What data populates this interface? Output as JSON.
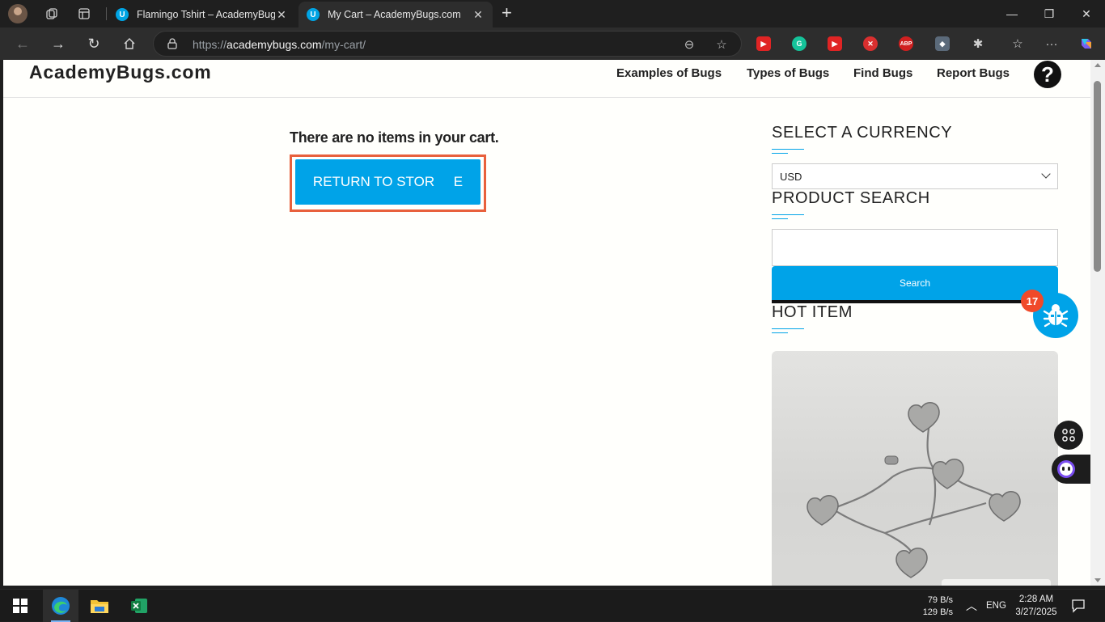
{
  "browser": {
    "tabs": [
      {
        "title": "Flamingo Tshirt – AcademyBugs.com",
        "favicon": "U",
        "active": false
      },
      {
        "title": "My Cart – AcademyBugs.com",
        "favicon": "U",
        "active": true
      }
    ],
    "url_scheme": "https://",
    "url_host": "academybugs.com",
    "url_path": "/my-cart/"
  },
  "site": {
    "logo": "AcademyBugs.com",
    "menu": [
      "Examples of Bugs",
      "Types of Bugs",
      "Find Bugs",
      "Report Bugs"
    ],
    "help_icon": "?"
  },
  "cart": {
    "empty_message": "There are no items in your cart.",
    "return_button": "RETURN TO STOR     E"
  },
  "sidebar": {
    "currency_title": "SELECT A CURRENCY",
    "currency_value": "USD",
    "search_title": "PRODUCT SEARCH",
    "search_button": "Search",
    "hot_item_title": "HOT ITEM"
  },
  "floating": {
    "bug_count": "17"
  },
  "taskbar": {
    "net_up": "79 B/s",
    "net_down": "129 B/s",
    "lang": "ENG",
    "time": "2:28 AM",
    "date": "3/27/2025"
  },
  "colors": {
    "accent": "#00a3e8",
    "highlight": "#e8603c"
  }
}
